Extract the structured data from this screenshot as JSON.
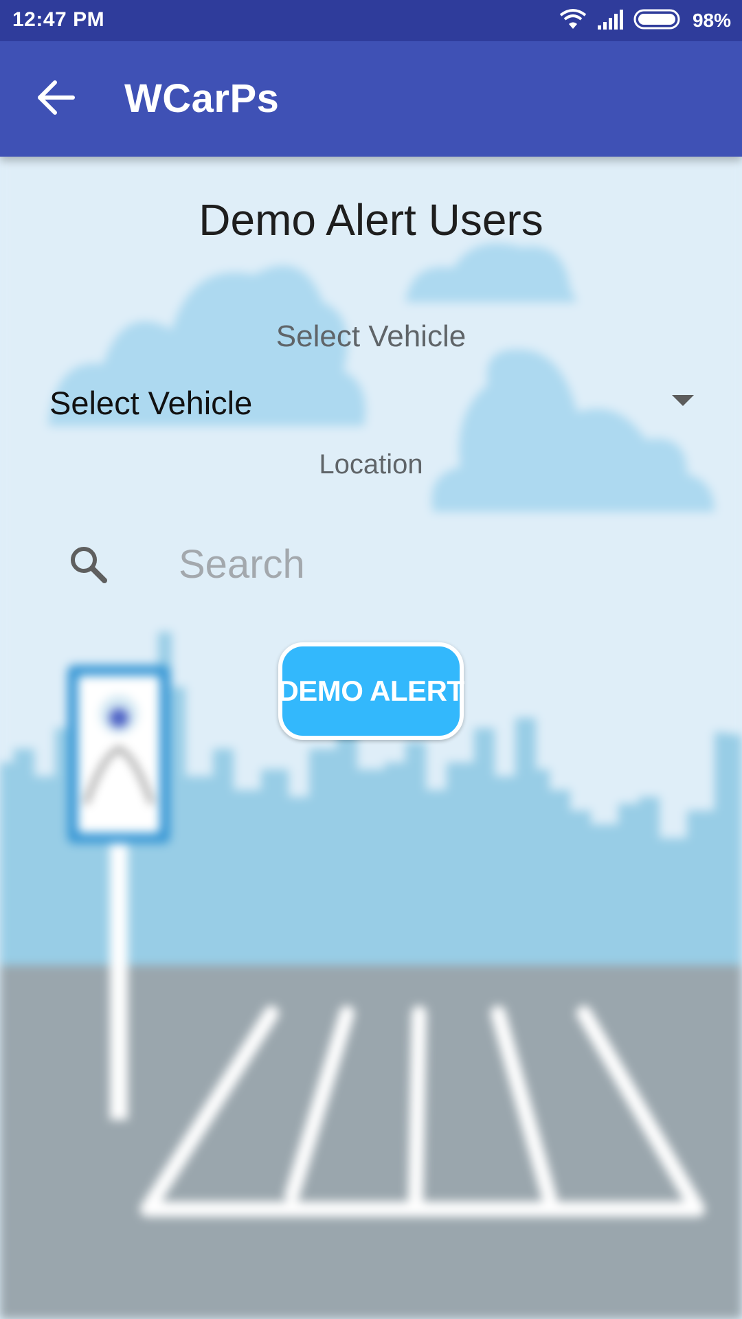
{
  "status_bar": {
    "time": "12:47 PM",
    "battery": "98%",
    "icons": [
      "wifi-icon",
      "signal-icon",
      "battery-icon"
    ]
  },
  "app_bar": {
    "title": "WCarPs",
    "back_icon": "arrow-back-icon"
  },
  "main": {
    "title": "Demo Alert Users",
    "vehicle_label": "Select Vehicle",
    "vehicle_selected": "Select Vehicle",
    "location_label": "Location",
    "search_placeholder": "Search",
    "search_value": "",
    "demo_button_label": "DEMO ALERT"
  },
  "colors": {
    "status_bar": "#2f3c9b",
    "app_bar": "#3f51b5",
    "button": "#33b8fc",
    "sky": "#dfeef8",
    "ground": "#9aa6ad"
  }
}
